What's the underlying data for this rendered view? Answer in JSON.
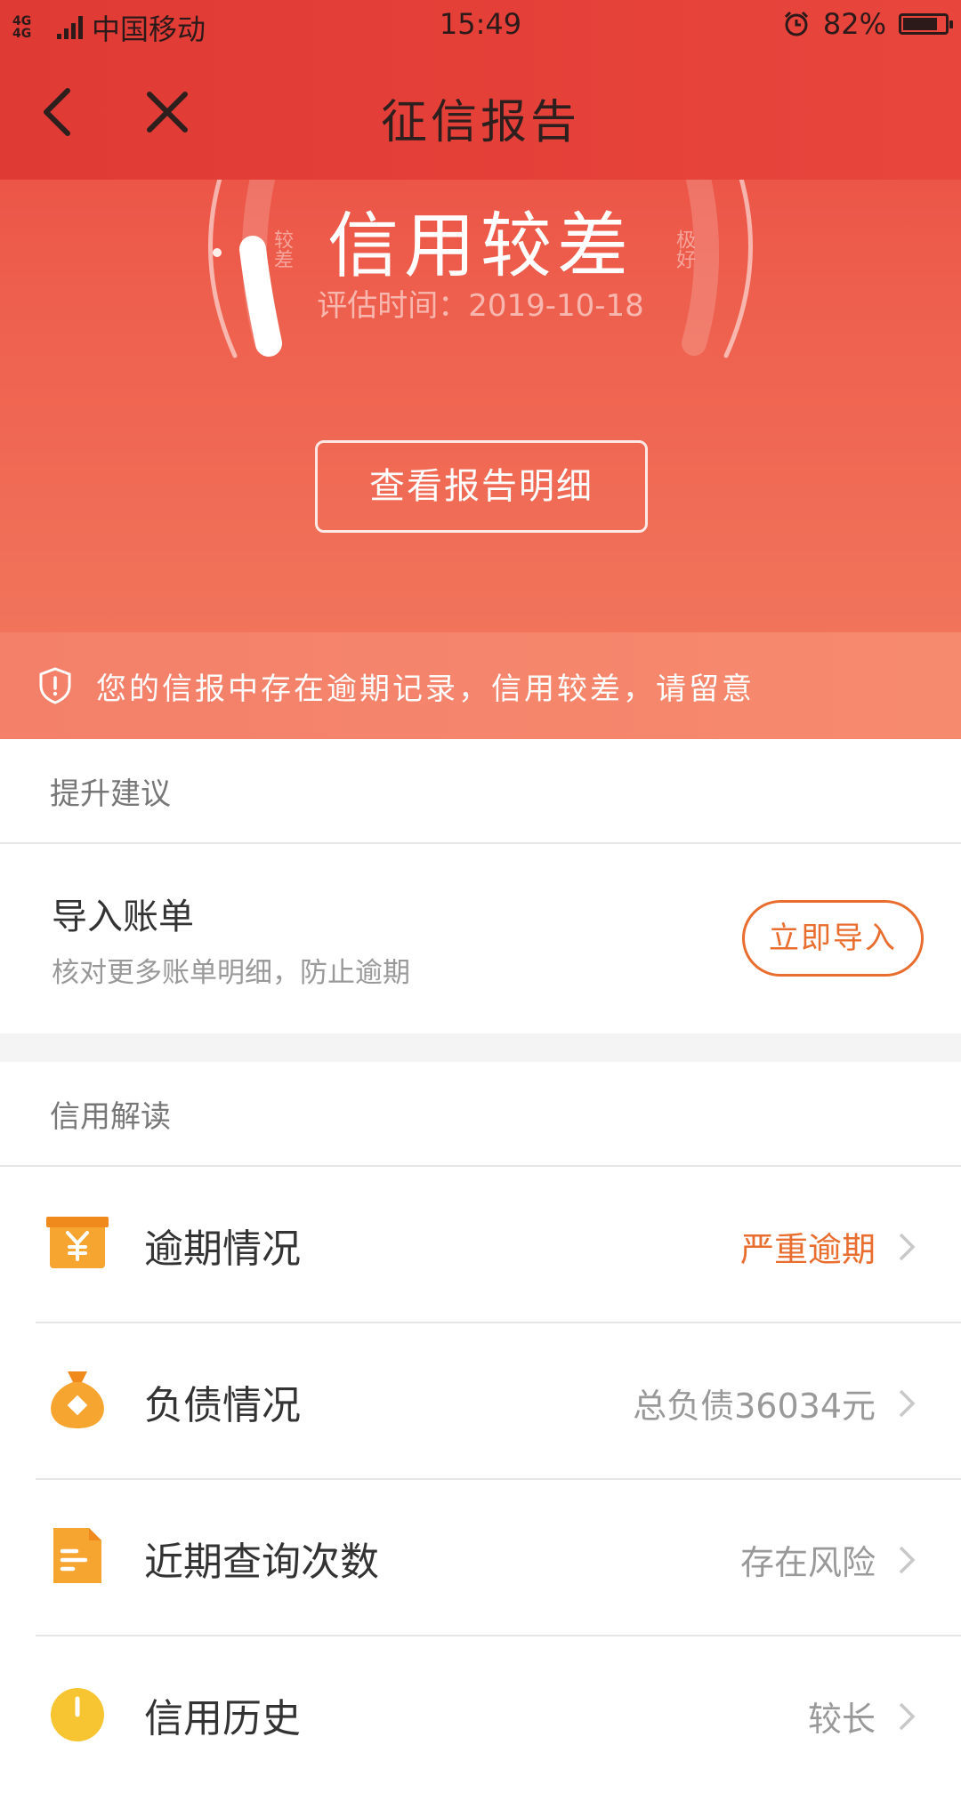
{
  "status": {
    "network": "4G 4G",
    "carrier": "中国移动",
    "time": "15:49",
    "battery": "82%",
    "battery_level": 0.82
  },
  "nav": {
    "title": "征信报告"
  },
  "report": {
    "level": "信用较差",
    "eval_time": "评估时间：2019-10-18",
    "gauge_low": "较差",
    "gauge_high": "极好",
    "detail_button": "查看报告明细"
  },
  "alert": {
    "text": "您的信报中存在逾期记录，信用较差，请留意"
  },
  "suggestion": {
    "header": "提升建议",
    "title": "导入账单",
    "subtitle": "核对更多账单明细，防止逾期",
    "button": "立即导入"
  },
  "interpretation": {
    "header": "信用解读",
    "items": [
      {
        "label": "逾期情况",
        "value": "严重逾期",
        "icon": "yuan-box-icon"
      },
      {
        "label": "负债情况",
        "value": "总负债36034元",
        "icon": "money-bag-icon"
      },
      {
        "label": "近期查询次数",
        "value": "存在风险",
        "icon": "document-icon"
      },
      {
        "label": "信用历史",
        "value": "较长",
        "icon": "history-icon"
      }
    ]
  },
  "colors": {
    "header_red": "#e03a34",
    "accent_orange": "#e96d2e",
    "alert_bg": "#f4806a"
  }
}
